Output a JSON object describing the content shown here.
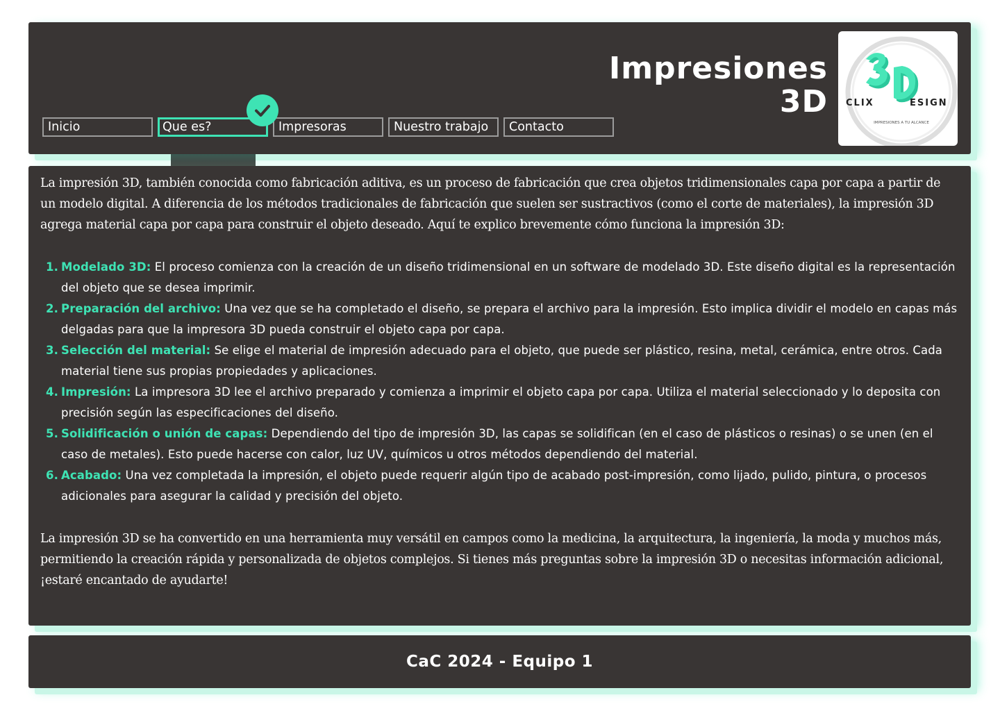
{
  "header": {
    "title_line1": "Impresiones",
    "title_line2": "3D",
    "nav": [
      {
        "label": "Inicio",
        "active": false
      },
      {
        "label": "Que es?",
        "active": true
      },
      {
        "label": "Impresoras",
        "active": false
      },
      {
        "label": "Nuestro trabajo",
        "active": false
      },
      {
        "label": "Contacto",
        "active": false
      }
    ],
    "active_badge_icon": "check-icon",
    "logo": {
      "word_left": "CLIX",
      "word_right": "ESIGN",
      "tagline": "IMPRESIONES A TU ALCANCE",
      "mark": "3D"
    }
  },
  "content": {
    "intro": "La impresión 3D, también conocida como fabricación aditiva, es un proceso de fabricación que crea objetos tridimensionales capa por capa a partir de un modelo digital. A diferencia de los métodos tradicionales de fabricación que suelen ser sustractivos (como el corte de materiales), la impresión 3D agrega material capa por capa para construir el objeto deseado. Aquí te explico brevemente cómo funciona la impresión 3D:",
    "steps": [
      {
        "num": "1.",
        "title": "Modelado 3D:",
        "text": " El proceso comienza con la creación de un diseño tridimensional en un software de modelado 3D. Este diseño digital es la representación del objeto que se desea imprimir."
      },
      {
        "num": "2.",
        "title": "Preparación del archivo:",
        "text": " Una vez que se ha completado el diseño, se prepara el archivo para la impresión. Esto implica dividir el modelo en capas más delgadas para que la impresora 3D pueda construir el objeto capa por capa."
      },
      {
        "num": "3.",
        "title": "Selección del material:",
        "text": " Se elige el material de impresión adecuado para el objeto, que puede ser plástico, resina, metal, cerámica, entre otros. Cada material tiene sus propias propiedades y aplicaciones."
      },
      {
        "num": "4.",
        "title": "Impresión:",
        "text": " La impresora 3D lee el archivo preparado y comienza a imprimir el objeto capa por capa. Utiliza el material seleccionado y lo deposita con precisión según las especificaciones del diseño."
      },
      {
        "num": "5.",
        "title": "Solidificación o unión de capas:",
        "text": " Dependiendo del tipo de impresión 3D, las capas se solidifican (en el caso de plásticos o resinas) o se unen (en el caso de metales). Esto puede hacerse con calor, luz UV, químicos u otros métodos dependiendo del material."
      },
      {
        "num": "6.",
        "title": "Acabado:",
        "text": " Una vez completada la impresión, el objeto puede requerir algún tipo de acabado post-impresión, como lijado, pulido, pintura, o procesos adicionales para asegurar la calidad y precisión del objeto."
      }
    ],
    "outro": "La impresión 3D se ha convertido en una herramienta muy versátil en campos como la medicina, la arquitectura, la ingeniería, la moda y muchos más, permitiendo la creación rápida y personalizada de objetos complejos. Si tienes más preguntas sobre la impresión 3D o necesitas información adicional, ¡estaré encantado de ayudarte!"
  },
  "footer": {
    "text": "CaC 2024 - Equipo 1"
  },
  "colors": {
    "panel": "#393534",
    "accent": "#3ee3b4",
    "shadow": "#c9f6e7",
    "nav_border": "#9c9c9c",
    "text": "#ffffff"
  }
}
